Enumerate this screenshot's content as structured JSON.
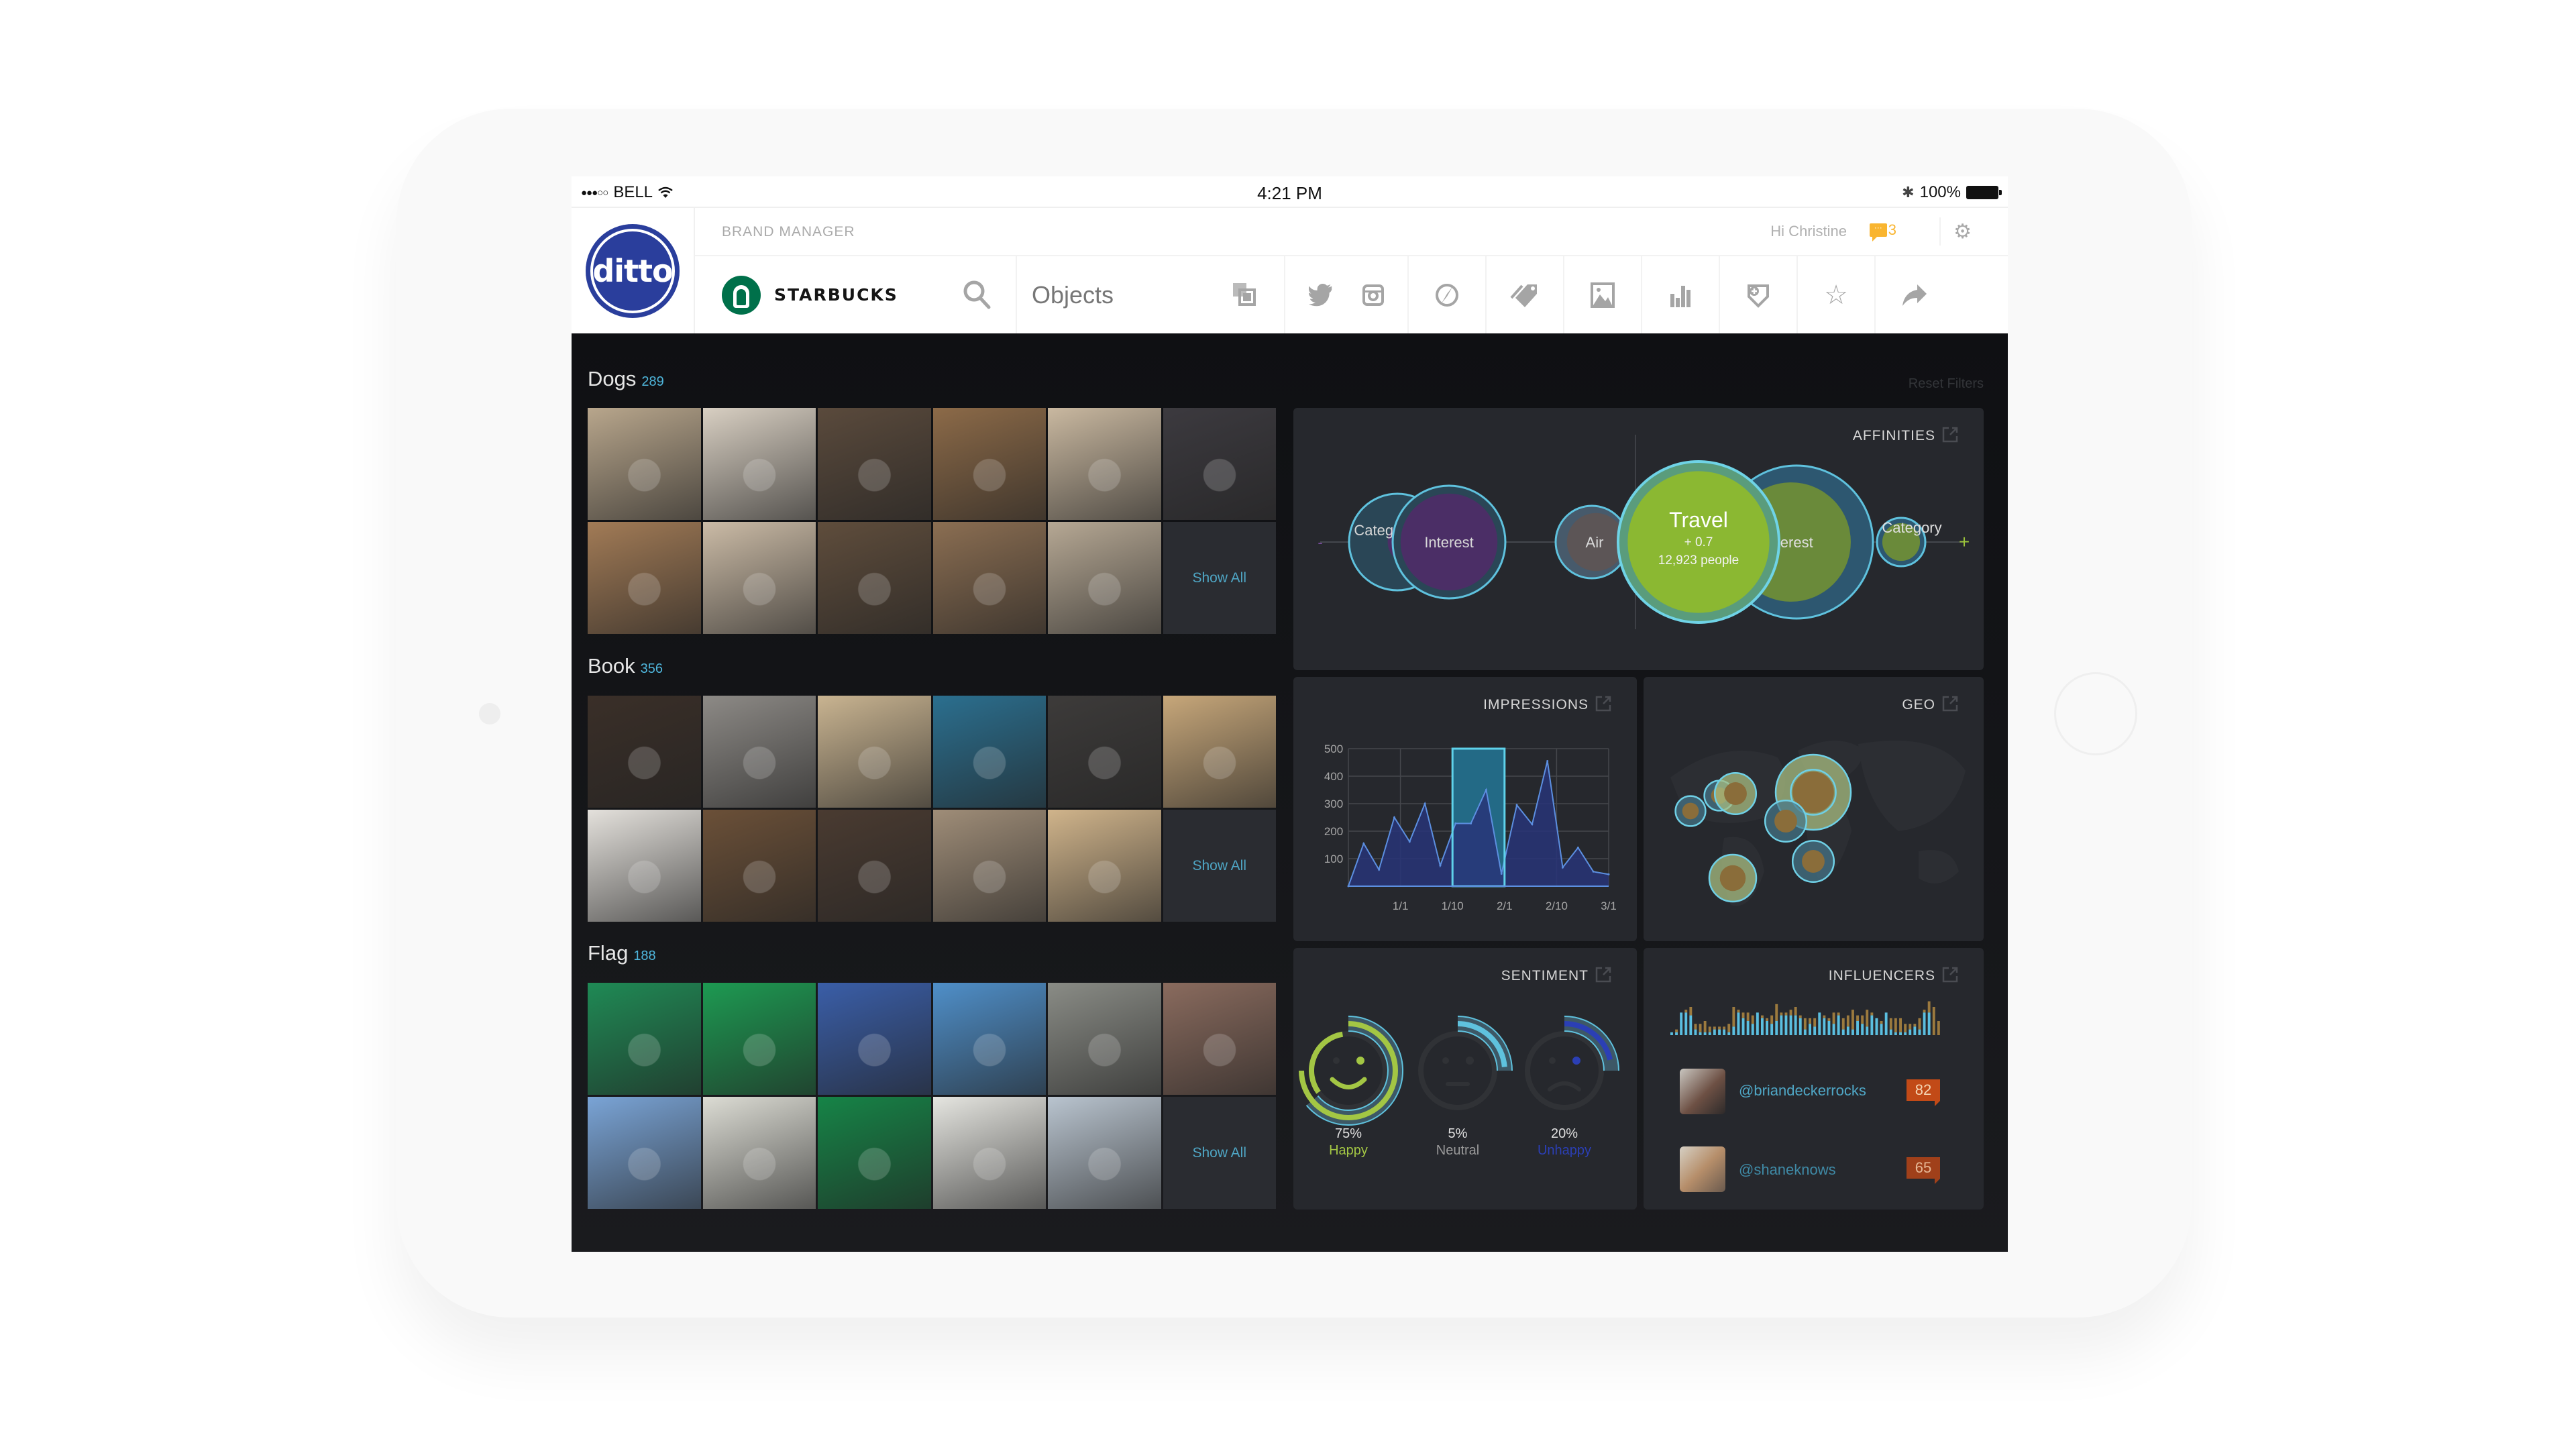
{
  "status_bar": {
    "carrier": "BELL",
    "signal_bars_filled": 3,
    "signal_bars_total": 5,
    "time": "4:21 PM",
    "battery": "100%"
  },
  "header": {
    "app_logo": "ditto",
    "section_label": "BRAND MANAGER",
    "greeting": "Hi Christine",
    "messages_count": "3",
    "brand_name": "STARBUCKS",
    "search": {
      "value": "Objects",
      "placeholder": "Objects"
    },
    "nav_icons": [
      "objects-icon",
      "twitter-icon",
      "instagram-icon",
      "compass-icon",
      "tags-icon",
      "image-icon",
      "bar-chart-icon",
      "add-tag-icon",
      "star-icon",
      "share-icon"
    ]
  },
  "main": {
    "reset_filters": "Reset Filters",
    "show_all": "Show All",
    "sections": [
      {
        "title": "Dogs",
        "count": "289",
        "thumbnails": 11
      },
      {
        "title": "Book",
        "count": "356",
        "thumbnails": 11
      },
      {
        "title": "Flag",
        "count": "188",
        "thumbnails": 11
      }
    ]
  },
  "panels": {
    "affinities": {
      "title": "AFFINITIES"
    },
    "impressions": {
      "title": "IMPRESSIONS"
    },
    "geo": {
      "title": "GEO"
    },
    "sentiment": {
      "title": "SENTIMENT"
    },
    "influencers": {
      "title": "INFLUENCERS",
      "people": [
        {
          "handle": "@briandeckerrocks",
          "score": "82"
        },
        {
          "handle": "@shaneknows",
          "score": "65"
        }
      ]
    }
  },
  "colors": {
    "accent_blue": "#4fb6dc",
    "happy_green": "#a3c644",
    "unhappy_blue": "#2b3fb5",
    "badge_orange": "#c24a17",
    "message_yellow": "#f9b530",
    "ditto_blue": "#2a3e9c",
    "starbucks_green": "#00704a"
  },
  "chart_data": [
    {
      "type": "bubble",
      "title": "AFFINITIES",
      "negative_side": [
        {
          "label": "Category",
          "size": 60,
          "color": "purple"
        },
        {
          "label": "Interest",
          "size": 70,
          "color": "purple"
        }
      ],
      "positive_side": [
        {
          "label": "Air",
          "size": 45,
          "color": "gray"
        },
        {
          "label": "Travel",
          "score": "+ 0.7",
          "people": "12,923 people",
          "size": 100,
          "color": "green",
          "selected": true
        },
        {
          "label": "Interest",
          "size": 95,
          "color": "green"
        },
        {
          "label": "Category",
          "size": 30,
          "color": "green"
        }
      ],
      "axis_ends": [
        "-",
        "+"
      ]
    },
    {
      "type": "area",
      "title": "IMPRESSIONS",
      "x_ticks": [
        "1/1",
        "1/10",
        "2/1",
        "2/10",
        "3/1"
      ],
      "y_ticks": [
        100,
        200,
        300,
        400,
        500
      ],
      "ylim": [
        0,
        500
      ],
      "values": [
        0,
        155,
        60,
        250,
        162,
        300,
        75,
        228,
        228,
        350,
        45,
        295,
        225,
        455,
        68,
        140,
        53,
        43
      ],
      "highlight_range": [
        "1/10",
        "2/1"
      ],
      "grid": true
    },
    {
      "type": "bubble-map",
      "title": "GEO",
      "points": [
        {
          "region": "North America West",
          "size": 2
        },
        {
          "region": "North America Central",
          "size": 2
        },
        {
          "region": "North America East",
          "size": 4
        },
        {
          "region": "South America",
          "size": 5
        },
        {
          "region": "Europe",
          "size": 10
        },
        {
          "region": "North Africa",
          "size": 4
        },
        {
          "region": "Southern Africa",
          "size": 4
        }
      ]
    },
    {
      "type": "radial",
      "title": "SENTIMENT",
      "series": [
        {
          "name": "Happy",
          "value": 75,
          "label": "75%"
        },
        {
          "name": "Neutral",
          "value": 5,
          "label": "5%"
        },
        {
          "name": "Unhappy",
          "value": 20,
          "label": "20%"
        }
      ]
    },
    {
      "type": "bar",
      "title": "INFLUENCERS activity",
      "stacked": true,
      "series": [
        {
          "name": "blue",
          "values": [
            1,
            1,
            8,
            8,
            7,
            2,
            1,
            1,
            1,
            2,
            2,
            2,
            1,
            3,
            8,
            6,
            5,
            4,
            8,
            6,
            5,
            4,
            5,
            7,
            7,
            7,
            7,
            6,
            2,
            4,
            3,
            8,
            6,
            5,
            4,
            7,
            2,
            3,
            2,
            5,
            4,
            3,
            7,
            6,
            4,
            8,
            2,
            1,
            1,
            1,
            2,
            3,
            2,
            8,
            8,
            0,
            0
          ]
        },
        {
          "name": "gold",
          "values": [
            0,
            1,
            0,
            1,
            3,
            2,
            3,
            4,
            2,
            1,
            1,
            1,
            3,
            7,
            1,
            2,
            3,
            3,
            0,
            1,
            1,
            3,
            6,
            1,
            1,
            2,
            3,
            1,
            4,
            2,
            3,
            0,
            1,
            1,
            4,
            1,
            4,
            4,
            7,
            2,
            3,
            6,
            1,
            0,
            1,
            0,
            4,
            5,
            5,
            3,
            2,
            1,
            4,
            1,
            4,
            10,
            5
          ]
        }
      ],
      "ylim": [
        0,
        10
      ]
    }
  ]
}
